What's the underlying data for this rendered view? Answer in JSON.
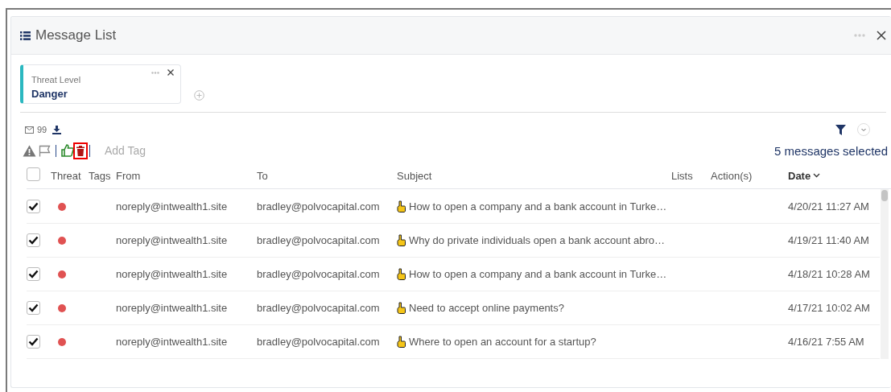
{
  "window": {
    "title": "Message List"
  },
  "filter_chip": {
    "label": "Threat Level",
    "value": "Danger"
  },
  "summary": {
    "count": "99"
  },
  "toolbar": {
    "items": [
      {
        "kind": "threat"
      },
      {
        "kind": "flag"
      },
      {
        "kind": "sep"
      },
      {
        "kind": "thumb"
      },
      {
        "kind": "trash",
        "highlighted": true
      },
      {
        "kind": "sep"
      }
    ],
    "add_tag": "Add Tag",
    "selection": "5 messages selected"
  },
  "table": {
    "select_all": {
      "checked": false
    },
    "columns": [
      "Threat",
      "Tags",
      "From",
      "To",
      "Subject",
      "Lists",
      "Action(s)",
      "Date"
    ],
    "rows": [
      {
        "checked": true,
        "color": "#e05252",
        "from": "noreply@intwealth1.site",
        "to": "bradley@polvocapital.com",
        "subject": "How to open a company and a bank account in Turke…",
        "date": "4/20/21 11:27 AM"
      },
      {
        "checked": true,
        "color": "#e05252",
        "from": "noreply@intwealth1.site",
        "to": "bradley@polvocapital.com",
        "subject": "Why do private individuals open a bank account abro…",
        "date": "4/19/21 11:40 AM"
      },
      {
        "checked": true,
        "color": "#e05252",
        "from": "noreply@intwealth1.site",
        "to": "bradley@polvocapital.com",
        "subject": "How to open a company and a bank account in Turke…",
        "date": "4/18/21 10:28 AM"
      },
      {
        "checked": true,
        "color": "#e05252",
        "from": "noreply@intwealth1.site",
        "to": "bradley@polvocapital.com",
        "subject": "Need to accept online payments?",
        "date": "4/17/21 10:02 AM"
      },
      {
        "checked": true,
        "color": "#e05252",
        "from": "noreply@intwealth1.site",
        "to": "bradley@polvocapital.com",
        "subject": "Where to open an account for a startup?",
        "date": "4/16/21 7:55 AM"
      }
    ]
  }
}
